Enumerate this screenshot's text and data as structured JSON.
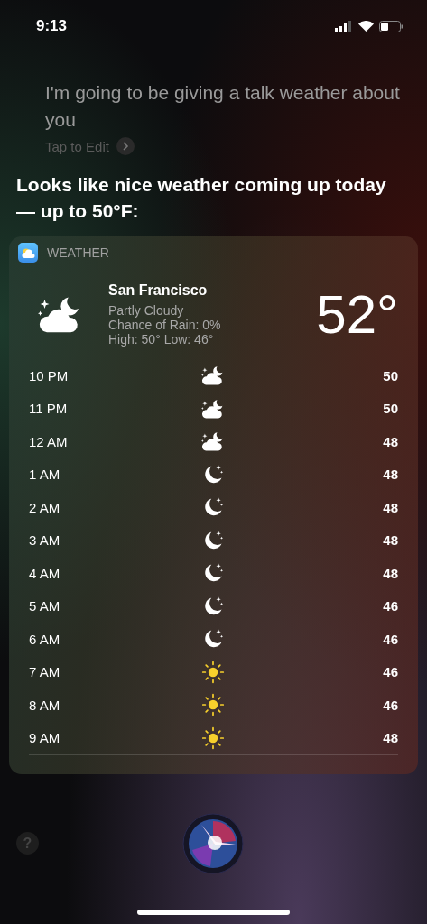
{
  "status_bar": {
    "time": "9:13"
  },
  "query": {
    "text": "I'm going to be giving a talk weather about you",
    "edit_label": "Tap to Edit"
  },
  "response": "Looks like nice weather coming up today — up to 50°F:",
  "weather_card": {
    "app_name": "WEATHER",
    "current": {
      "kind": "cloud-moon",
      "city": "San Francisco",
      "condition": "Partly Cloudy",
      "rain": "Chance of Rain: 0%",
      "high_low": "High: 50° Low: 46°",
      "temperature": "52°"
    },
    "hours": [
      {
        "time": "10 PM",
        "kind": "cloud-moon",
        "temp": "50"
      },
      {
        "time": "11 PM",
        "kind": "cloud-moon",
        "temp": "50"
      },
      {
        "time": "12 AM",
        "kind": "cloud-moon",
        "temp": "48"
      },
      {
        "time": "1 AM",
        "kind": "moon",
        "temp": "48"
      },
      {
        "time": "2 AM",
        "kind": "moon",
        "temp": "48"
      },
      {
        "time": "3 AM",
        "kind": "moon",
        "temp": "48"
      },
      {
        "time": "4 AM",
        "kind": "moon",
        "temp": "48"
      },
      {
        "time": "5 AM",
        "kind": "moon",
        "temp": "46"
      },
      {
        "time": "6 AM",
        "kind": "moon",
        "temp": "46"
      },
      {
        "time": "7 AM",
        "kind": "sun",
        "temp": "46"
      },
      {
        "time": "8 AM",
        "kind": "sun",
        "temp": "46"
      },
      {
        "time": "9 AM",
        "kind": "sun",
        "temp": "48"
      }
    ]
  },
  "help_button": "?"
}
